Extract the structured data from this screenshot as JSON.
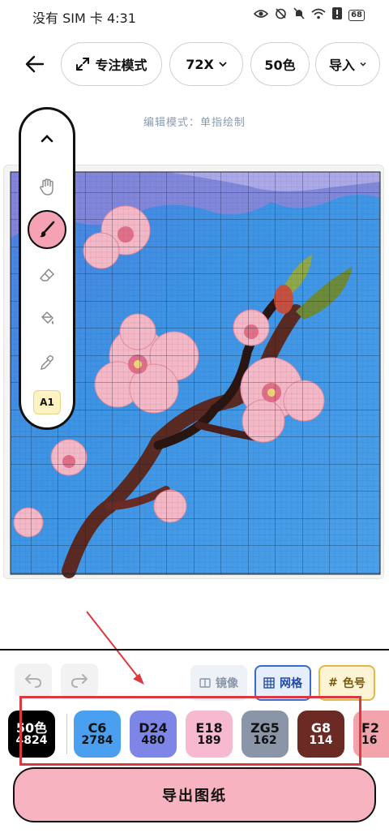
{
  "status_bar": {
    "carrier_time": "没有 SIM 卡 4:31",
    "battery": "68",
    "icons": [
      "eye-icon",
      "alarm-off-icon",
      "bell-off-icon",
      "wifi-icon",
      "alert-icon",
      "battery-icon"
    ]
  },
  "toolbar": {
    "back_icon": "arrow-left-icon",
    "focus_mode": "专注模式",
    "zoom": "72X",
    "colors": "50色",
    "import": "导入"
  },
  "mode_label": "编辑模式：单指绘制",
  "tool_panel": {
    "tools": [
      "chevron-up-icon",
      "hand-icon",
      "brush-icon",
      "eraser-icon",
      "fill-bucket-icon",
      "eyedropper-icon"
    ],
    "active_tool": "brush-icon",
    "cell_label": "A1"
  },
  "controls": {
    "undo_icon": "undo-icon",
    "redo_icon": "redo-icon",
    "mirror": "镜像",
    "grid": "网格",
    "color_code": "色号",
    "color_code_symbol": "#"
  },
  "palette": [
    {
      "code": "50色",
      "count": "4824",
      "color": "#000000",
      "text": "#ffffff"
    },
    {
      "code": "C6",
      "count": "2784",
      "color": "#4a9ff0",
      "text": "#111111"
    },
    {
      "code": "D24",
      "count": "480",
      "color": "#7d86e6",
      "text": "#111111"
    },
    {
      "code": "E18",
      "count": "189",
      "color": "#f7b9d0",
      "text": "#111111"
    },
    {
      "code": "ZG5",
      "count": "162",
      "color": "#8b95a8",
      "text": "#111111"
    },
    {
      "code": "G8",
      "count": "114",
      "color": "#6b2a24",
      "text": "#ffffff"
    },
    {
      "code": "F2",
      "count": "16",
      "color": "#f3a3ac",
      "text": "#111111"
    }
  ],
  "export_button": "导出图纸",
  "colors": {
    "accent_pink": "#f7b3c0",
    "annotation_red": "#d9393f",
    "sky_blue": "#3d94e4"
  }
}
